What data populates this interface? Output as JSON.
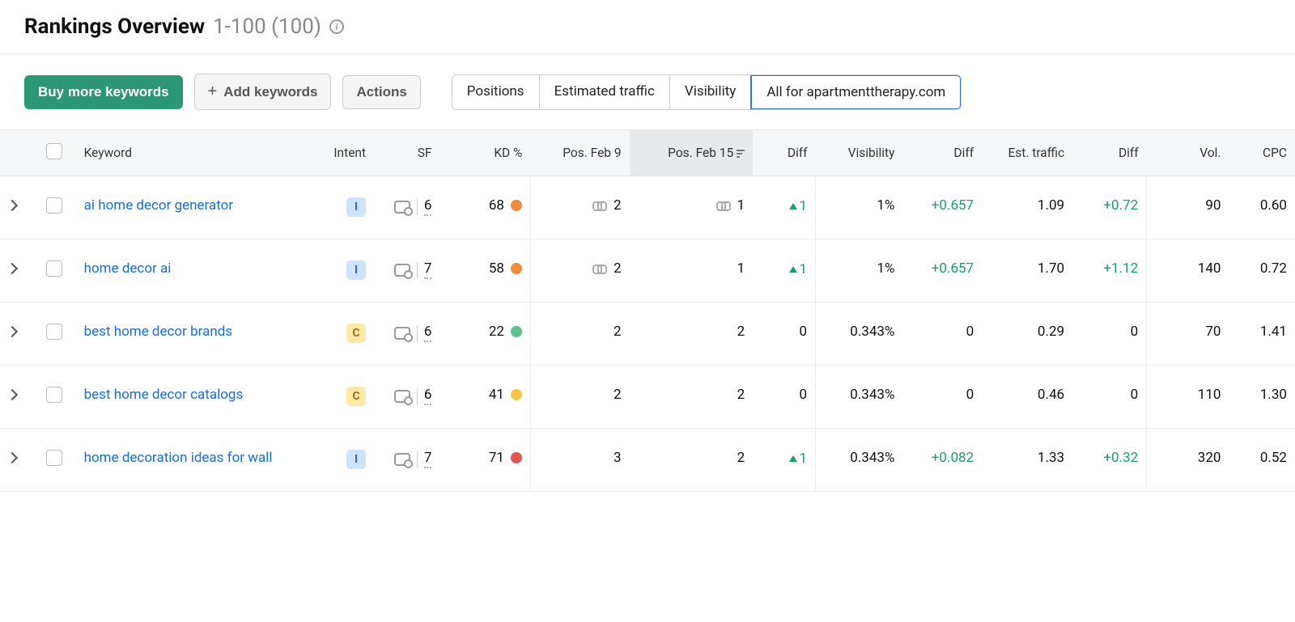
{
  "header": {
    "title": "Rankings Overview",
    "range": "1-100 (100)"
  },
  "toolbar": {
    "buy": "Buy more keywords",
    "add": "Add keywords",
    "actions": "Actions",
    "seg": [
      "Positions",
      "Estimated traffic",
      "Visibility",
      "All for apartmenttherapy.com"
    ],
    "seg_active": 3
  },
  "columns": {
    "keyword": "Keyword",
    "intent": "Intent",
    "sf": "SF",
    "kd": "KD %",
    "pos9": "Pos. Feb 9",
    "pos15": "Pos. Feb 15",
    "diff": "Diff",
    "vis": "Visibility",
    "visdiff": "Diff",
    "est": "Est. traffic",
    "estdiff": "Diff",
    "vol": "Vol.",
    "cpc": "CPC"
  },
  "rows": [
    {
      "keyword": "ai home decor generator",
      "intent": "I",
      "sf": "6",
      "kd": "68",
      "kd_color": "orange",
      "pos9": "2",
      "pos9_link": true,
      "pos15": "1",
      "pos15_link": true,
      "diff": "1",
      "diff_up": true,
      "vis": "1%",
      "visdiff": "+0.657",
      "visdiff_pos": true,
      "est": "1.09",
      "estdiff": "+0.72",
      "estdiff_pos": true,
      "vol": "90",
      "cpc": "0.60"
    },
    {
      "keyword": "home decor ai",
      "intent": "I",
      "sf": "7",
      "kd": "58",
      "kd_color": "orange",
      "pos9": "2",
      "pos9_link": true,
      "pos15": "1",
      "pos15_link": false,
      "diff": "1",
      "diff_up": true,
      "vis": "1%",
      "visdiff": "+0.657",
      "visdiff_pos": true,
      "est": "1.70",
      "estdiff": "+1.12",
      "estdiff_pos": true,
      "vol": "140",
      "cpc": "0.72"
    },
    {
      "keyword": "best home decor brands",
      "intent": "C",
      "sf": "6",
      "kd": "22",
      "kd_color": "green",
      "pos9": "2",
      "pos9_link": false,
      "pos15": "2",
      "pos15_link": false,
      "diff": "0",
      "diff_up": false,
      "vis": "0.343%",
      "visdiff": "0",
      "visdiff_pos": false,
      "est": "0.29",
      "estdiff": "0",
      "estdiff_pos": false,
      "vol": "70",
      "cpc": "1.41"
    },
    {
      "keyword": "best home decor catalogs",
      "intent": "C",
      "sf": "6",
      "kd": "41",
      "kd_color": "yellow",
      "pos9": "2",
      "pos9_link": false,
      "pos15": "2",
      "pos15_link": false,
      "diff": "0",
      "diff_up": false,
      "vis": "0.343%",
      "visdiff": "0",
      "visdiff_pos": false,
      "est": "0.46",
      "estdiff": "0",
      "estdiff_pos": false,
      "vol": "110",
      "cpc": "1.30"
    },
    {
      "keyword": "home decoration ideas for wall",
      "intent": "I",
      "sf": "7",
      "kd": "71",
      "kd_color": "red",
      "pos9": "3",
      "pos9_link": false,
      "pos15": "2",
      "pos15_link": false,
      "diff": "1",
      "diff_up": true,
      "vis": "0.343%",
      "visdiff": "+0.082",
      "visdiff_pos": true,
      "est": "1.33",
      "estdiff": "+0.32",
      "estdiff_pos": true,
      "vol": "320",
      "cpc": "0.52"
    }
  ]
}
